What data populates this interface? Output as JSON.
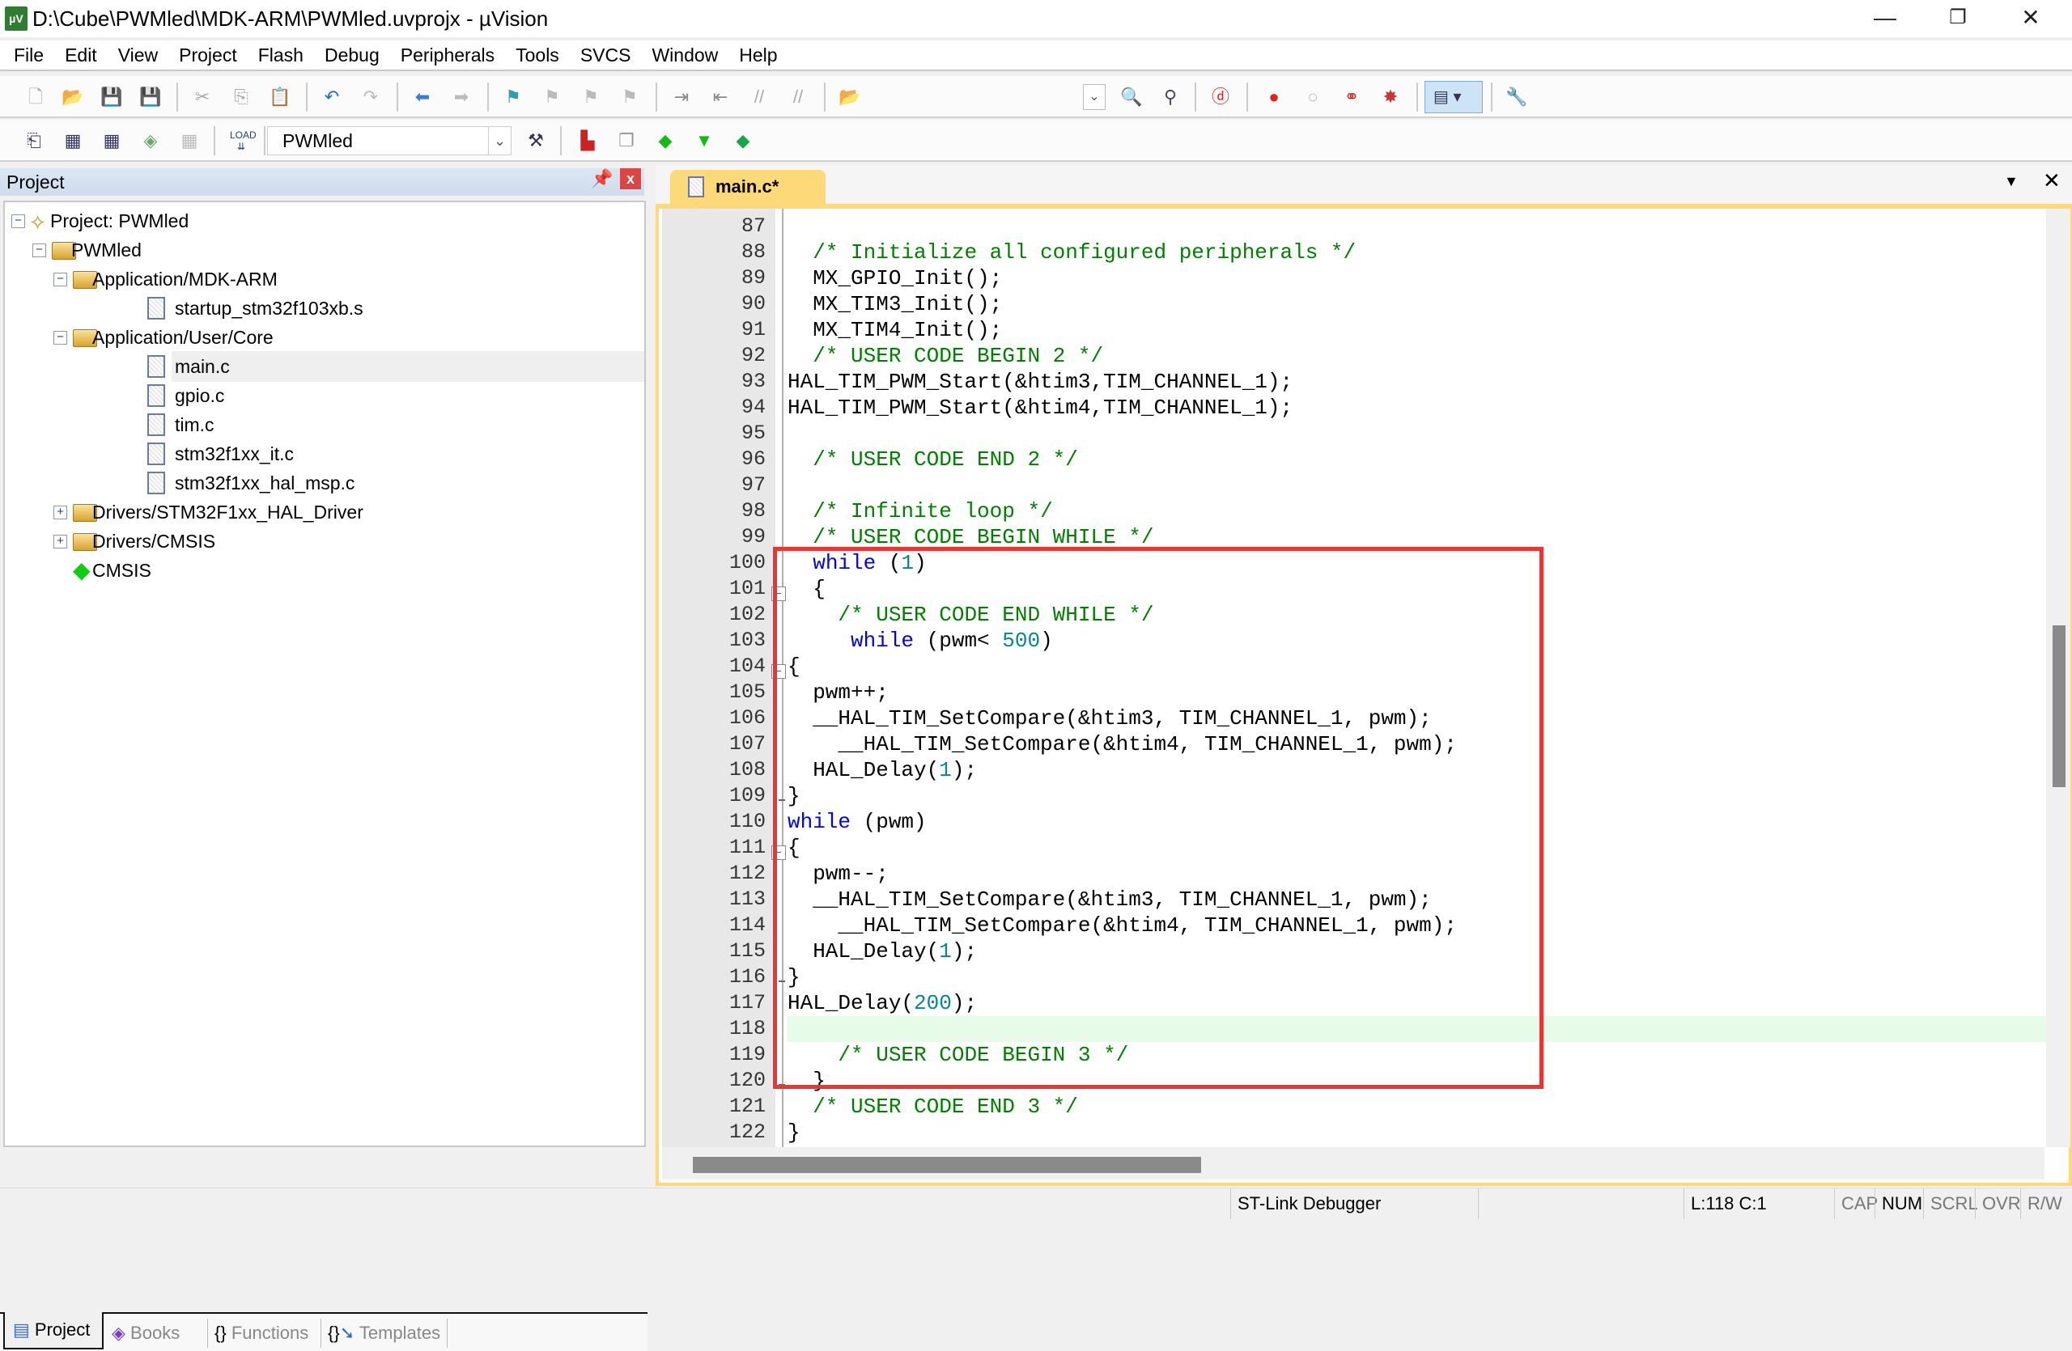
{
  "window": {
    "title": "D:\\Cube\\PWMled\\MDK-ARM\\PWMled.uvprojx - µVision",
    "app_icon": "uv"
  },
  "menu": [
    "File",
    "Edit",
    "View",
    "Project",
    "Flash",
    "Debug",
    "Peripherals",
    "Tools",
    "SVCS",
    "Window",
    "Help"
  ],
  "toolbar2": {
    "target": "PWMled"
  },
  "project_panel": {
    "title": "Project",
    "tree": [
      {
        "label": "Project: PWMled",
        "level": 0,
        "type": "project",
        "expander": "−"
      },
      {
        "label": "PWMled",
        "level": 1,
        "type": "target",
        "expander": "−"
      },
      {
        "label": "Application/MDK-ARM",
        "level": 2,
        "type": "folder",
        "expander": "−"
      },
      {
        "label": "startup_stm32f103xb.s",
        "level": 3,
        "type": "file"
      },
      {
        "label": "Application/User/Core",
        "level": 2,
        "type": "folder",
        "expander": "−"
      },
      {
        "label": "main.c",
        "level": 3,
        "type": "file",
        "selected": true
      },
      {
        "label": "gpio.c",
        "level": 3,
        "type": "file"
      },
      {
        "label": "tim.c",
        "level": 3,
        "type": "file"
      },
      {
        "label": "stm32f1xx_it.c",
        "level": 3,
        "type": "file"
      },
      {
        "label": "stm32f1xx_hal_msp.c",
        "level": 3,
        "type": "file"
      },
      {
        "label": "Drivers/STM32F1xx_HAL_Driver",
        "level": 2,
        "type": "folder",
        "expander": "+"
      },
      {
        "label": "Drivers/CMSIS",
        "level": 2,
        "type": "folder",
        "expander": "+"
      },
      {
        "label": "CMSIS",
        "level": 2,
        "type": "component"
      }
    ],
    "bottom_tabs": [
      {
        "label": "Project",
        "active": true
      },
      {
        "label": "Books"
      },
      {
        "label": "Functions",
        "icon": "{}"
      },
      {
        "label": "Templates",
        "icon": "{}"
      }
    ]
  },
  "editor": {
    "tab": "main.c*",
    "current_line": 118,
    "lines": [
      {
        "n": "87",
        "s": []
      },
      {
        "n": "88",
        "s": [
          [
            "",
            "  "
          ],
          [
            "cm",
            "/* Initialize all configured peripherals */"
          ]
        ]
      },
      {
        "n": "89",
        "s": [
          [
            "",
            "  MX_GPIO_Init();"
          ]
        ]
      },
      {
        "n": "90",
        "s": [
          [
            "",
            "  MX_TIM3_Init();"
          ]
        ]
      },
      {
        "n": "91",
        "s": [
          [
            "",
            "  MX_TIM4_Init();"
          ]
        ]
      },
      {
        "n": "92",
        "s": [
          [
            "",
            "  "
          ],
          [
            "cm",
            "/* USER CODE BEGIN 2 */"
          ]
        ]
      },
      {
        "n": "93",
        "s": [
          [
            "",
            "HAL_TIM_PWM_Start(&htim3,TIM_CHANNEL_1);"
          ]
        ]
      },
      {
        "n": "94",
        "s": [
          [
            "",
            "HAL_TIM_PWM_Start(&htim4,TIM_CHANNEL_1);"
          ]
        ]
      },
      {
        "n": "95",
        "s": []
      },
      {
        "n": "96",
        "s": [
          [
            "",
            "  "
          ],
          [
            "cm",
            "/* USER CODE END 2 */"
          ]
        ]
      },
      {
        "n": "97",
        "s": []
      },
      {
        "n": "98",
        "s": [
          [
            "",
            "  "
          ],
          [
            "cm",
            "/* Infinite loop */"
          ]
        ]
      },
      {
        "n": "99",
        "s": [
          [
            "",
            "  "
          ],
          [
            "cm",
            "/* USER CODE BEGIN WHILE */"
          ]
        ]
      },
      {
        "n": "100",
        "s": [
          [
            "",
            "  "
          ],
          [
            "kw",
            "while"
          ],
          [
            "",
            " ("
          ],
          [
            "nm",
            "1"
          ],
          [
            "",
            ")"
          ]
        ]
      },
      {
        "n": "101",
        "s": [
          [
            "",
            "  {"
          ]
        ],
        "fold": "open"
      },
      {
        "n": "102",
        "s": [
          [
            "",
            "    "
          ],
          [
            "cm",
            "/* USER CODE END WHILE */"
          ]
        ]
      },
      {
        "n": "103",
        "s": [
          [
            "",
            "     "
          ],
          [
            "kw",
            "while"
          ],
          [
            "",
            " (pwm< "
          ],
          [
            "nm",
            "500"
          ],
          [
            "",
            ")"
          ]
        ]
      },
      {
        "n": "104",
        "s": [
          [
            "",
            "{"
          ]
        ],
        "fold": "open"
      },
      {
        "n": "105",
        "s": [
          [
            "",
            "  pwm++;"
          ]
        ]
      },
      {
        "n": "106",
        "s": [
          [
            "",
            "  __HAL_TIM_SetCompare(&htim3, TIM_CHANNEL_1, pwm);"
          ]
        ]
      },
      {
        "n": "107",
        "s": [
          [
            "",
            "    __HAL_TIM_SetCompare(&htim4, TIM_CHANNEL_1, pwm);"
          ]
        ]
      },
      {
        "n": "108",
        "s": [
          [
            "",
            "  HAL_Delay("
          ],
          [
            "nm",
            "1"
          ],
          [
            "",
            ");"
          ]
        ]
      },
      {
        "n": "109",
        "s": [
          [
            "",
            "}"
          ]
        ],
        "fold": "end"
      },
      {
        "n": "110",
        "s": [
          [
            "kw",
            "while"
          ],
          [
            "",
            " (pwm)"
          ]
        ]
      },
      {
        "n": "111",
        "s": [
          [
            "",
            "{"
          ]
        ],
        "fold": "open"
      },
      {
        "n": "112",
        "s": [
          [
            "",
            "  pwm--;"
          ]
        ]
      },
      {
        "n": "113",
        "s": [
          [
            "",
            "  __HAL_TIM_SetCompare(&htim3, TIM_CHANNEL_1, pwm);"
          ]
        ]
      },
      {
        "n": "114",
        "s": [
          [
            "",
            "    __HAL_TIM_SetCompare(&htim4, TIM_CHANNEL_1, pwm);"
          ]
        ]
      },
      {
        "n": "115",
        "s": [
          [
            "",
            "  HAL_Delay("
          ],
          [
            "nm",
            "1"
          ],
          [
            "",
            ");"
          ]
        ]
      },
      {
        "n": "116",
        "s": [
          [
            "",
            "}"
          ]
        ],
        "fold": "end"
      },
      {
        "n": "117",
        "s": [
          [
            "",
            "HAL_Delay("
          ],
          [
            "nm",
            "200"
          ],
          [
            "",
            ");"
          ]
        ]
      },
      {
        "n": "118",
        "s": []
      },
      {
        "n": "119",
        "s": [
          [
            "",
            "    "
          ],
          [
            "cm",
            "/* USER CODE BEGIN 3 */"
          ]
        ]
      },
      {
        "n": "120",
        "s": [
          [
            "",
            "  }"
          ]
        ],
        "fold": "end"
      },
      {
        "n": "121",
        "s": [
          [
            "",
            "  "
          ],
          [
            "cm",
            "/* USER CODE END 3 */"
          ]
        ]
      },
      {
        "n": "122",
        "s": [
          [
            "",
            "}"
          ]
        ]
      }
    ]
  },
  "status": {
    "debugger": "ST-Link Debugger",
    "position": "L:118 C:1",
    "cap": "CAP",
    "num": "NUM",
    "scrl": "SCRL",
    "ovr": "OVR",
    "rw": "R/W"
  },
  "colors": {
    "comment": "#008000",
    "keyword": "#0000ff",
    "number": "#008a8a",
    "highlight_box": "#ee3333",
    "tab_active": "#fdd97a",
    "current_line": "#e6fbe8"
  }
}
